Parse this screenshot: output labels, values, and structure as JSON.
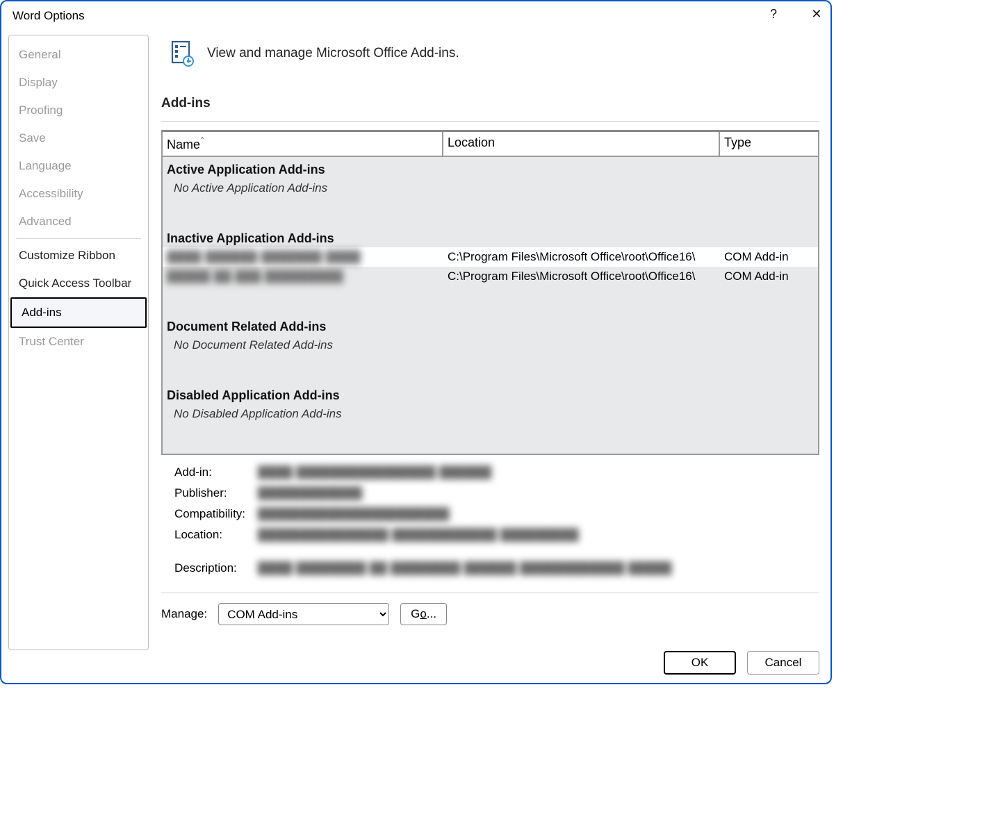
{
  "window": {
    "title": "Word Options"
  },
  "sidebar": {
    "items": [
      {
        "label": "General",
        "enabled": false
      },
      {
        "label": "Display",
        "enabled": false
      },
      {
        "label": "Proofing",
        "enabled": false
      },
      {
        "label": "Save",
        "enabled": false
      },
      {
        "label": "Language",
        "enabled": false
      },
      {
        "label": "Accessibility",
        "enabled": false
      },
      {
        "label": "Advanced",
        "enabled": false
      }
    ],
    "items2": [
      {
        "label": "Customize Ribbon"
      },
      {
        "label": "Quick Access Toolbar"
      },
      {
        "label": "Add-ins",
        "selected": true
      },
      {
        "label": "Trust Center",
        "enabled": false
      }
    ]
  },
  "header": {
    "title": "View and manage Microsoft Office Add-ins."
  },
  "section": {
    "title": "Add-ins"
  },
  "table": {
    "columns": {
      "name": "Name",
      "sort": "ˆ",
      "location": "Location",
      "type": "Type"
    },
    "groups": {
      "active": {
        "title": "Active Application Add-ins",
        "empty": "No Active Application Add-ins"
      },
      "inactive": {
        "title": "Inactive Application Add-ins",
        "rows": [
          {
            "name_blurred": "████ ██████ ███████ ████",
            "location": "C:\\Program Files\\Microsoft Office\\root\\Office16\\",
            "type": "COM Add-in",
            "selected": true
          },
          {
            "name_blurred": "█████ ██ ███ █████████",
            "location": "C:\\Program Files\\Microsoft Office\\root\\Office16\\",
            "type": "COM Add-in"
          }
        ]
      },
      "document": {
        "title": "Document Related Add-ins",
        "empty": "No Document Related Add-ins"
      },
      "disabled": {
        "title": "Disabled Application Add-ins",
        "empty": "No Disabled Application Add-ins"
      }
    }
  },
  "details": {
    "labels": {
      "addin": "Add-in:",
      "publisher": "Publisher:",
      "compat": "Compatibility:",
      "location": "Location:",
      "description": "Description:"
    },
    "values": {
      "addin": "████ ████████████████ ██████",
      "publisher": "████████████",
      "compat": "██████████████████████",
      "location": "███████████████ ████████████ █████████",
      "description": "████ ████████ ██ ████████ ██████ ████████████ █████"
    }
  },
  "manage": {
    "label": "Manage:",
    "selected": "COM Add-ins",
    "go_prefix": "G",
    "go_underlined": "o",
    "go_suffix": "..."
  },
  "footer": {
    "ok": "OK",
    "cancel": "Cancel"
  }
}
